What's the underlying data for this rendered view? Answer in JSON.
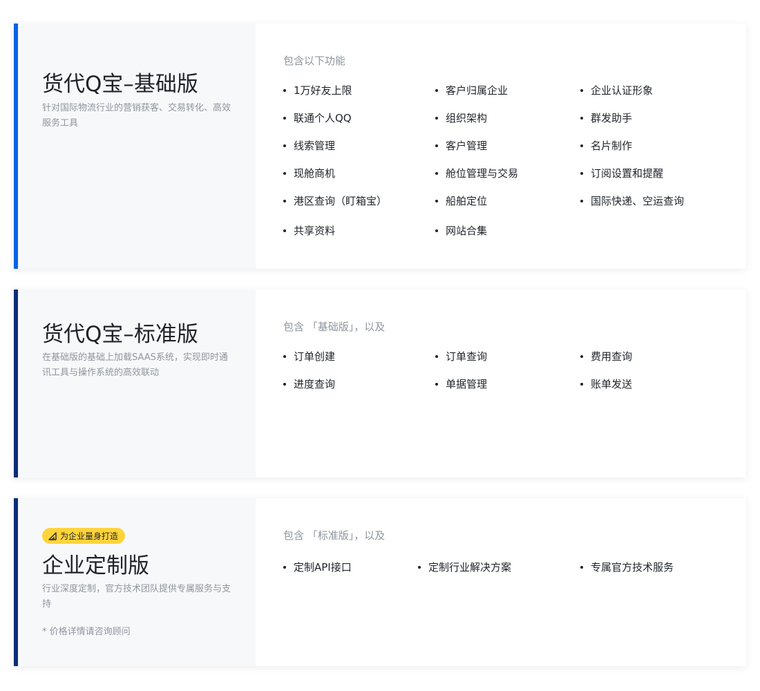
{
  "plans": [
    {
      "title": "货代Q宝–基础版",
      "description": "针对国际物流行业的营销获客、交易转化、高效服务工具",
      "features_heading": "包含以下功能",
      "features": [
        "1万好友上限",
        "客户归属企业",
        "企业认证形象",
        "联通个人QQ",
        "组织架构",
        "群发助手",
        "线索管理",
        "客户管理",
        "名片制作",
        "现舱商机",
        "舱位管理与交易",
        "订阅设置和提醒",
        "港区查询（盯箱宝）",
        "船舶定位",
        "国际快递、空运查询",
        "共享资料",
        "网站合集"
      ]
    },
    {
      "title": "货代Q宝–标准版",
      "description": "在基础版的基础上加载SAAS系统，实现即时通讯工具与操作系统的高效联动",
      "features_heading": "包含 「基础版」，以及",
      "features": [
        "订单创建",
        "订单查询",
        "费用查询",
        "进度查询",
        "单据管理",
        "账单发送"
      ]
    },
    {
      "badge": "为企业量身打造",
      "badge_icon": "ruler-triangle-icon",
      "title": "企业定制版",
      "description": "行业深度定制，官方技术团队提供专属服务与支持",
      "price_note": "* 价格详情请咨询顾问",
      "features_heading": "包含 「标准版」，以及",
      "features": [
        "定制API接口",
        "定制行业解决方案",
        "专属官方技术服务"
      ]
    }
  ],
  "colors": {
    "basic_accent": "#0a63e6",
    "standard_accent": "#0c2d7a",
    "enterprise_accent": "#0c2d7a",
    "badge_bg": "#ffd43b",
    "panel_bg": "#f7f8fa",
    "muted_text": "#8f959e"
  }
}
